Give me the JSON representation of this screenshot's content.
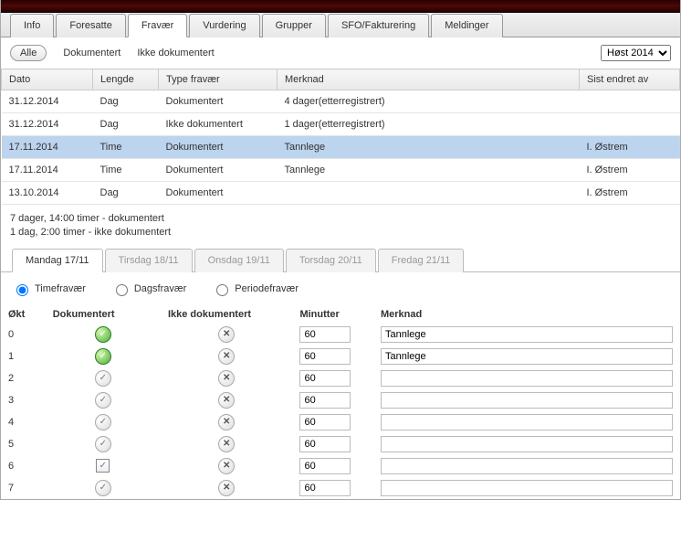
{
  "tabs": {
    "info": "Info",
    "foresatte": "Foresatte",
    "fravaer": "Fravær",
    "vurdering": "Vurdering",
    "grupper": "Grupper",
    "sfo": "SFO/Fakturering",
    "meldinger": "Meldinger"
  },
  "filter": {
    "alle": "Alle",
    "dokumentert": "Dokumentert",
    "ikke_dokumentert": "Ikke dokumentert",
    "semester": "Høst 2014"
  },
  "grid": {
    "headers": {
      "dato": "Dato",
      "lengde": "Lengde",
      "type": "Type fravær",
      "merknad": "Merknad",
      "sist": "Sist endret av"
    },
    "rows": [
      {
        "dato": "31.12.2014",
        "lengde": "Dag",
        "type": "Dokumentert",
        "merknad": "4 dager(etterregistrert)",
        "sist": "",
        "sel": false
      },
      {
        "dato": "31.12.2014",
        "lengde": "Dag",
        "type": "Ikke dokumentert",
        "merknad": "1 dager(etterregistrert)",
        "sist": "",
        "sel": false
      },
      {
        "dato": "17.11.2014",
        "lengde": "Time",
        "type": "Dokumentert",
        "merknad": "Tannlege",
        "sist": "I. Østrem",
        "sel": true
      },
      {
        "dato": "17.11.2014",
        "lengde": "Time",
        "type": "Dokumentert",
        "merknad": "Tannlege",
        "sist": "I. Østrem",
        "sel": false
      },
      {
        "dato": "13.10.2014",
        "lengde": "Dag",
        "type": "Dokumentert",
        "merknad": "",
        "sist": "I. Østrem",
        "sel": false
      }
    ]
  },
  "summary": {
    "line1": "7 dager, 14:00 timer - dokumentert",
    "line2": "1 dag, 2:00 timer - ikke dokumentert"
  },
  "days": {
    "mon": "Mandag 17/11",
    "tue": "Tirsdag 18/11",
    "wed": "Onsdag 19/11",
    "thu": "Torsdag 20/11",
    "fri": "Fredag 21/11"
  },
  "radios": {
    "time": "Timefravær",
    "dag": "Dagsfravær",
    "periode": "Periodefravær"
  },
  "okt": {
    "headers": {
      "okt": "Økt",
      "dok": "Dokumentert",
      "ikke": "Ikke dokumentert",
      "min": "Minutter",
      "merk": "Merknad"
    },
    "rows": [
      {
        "n": "0",
        "dok": "green",
        "min": "60",
        "merk": "Tannlege"
      },
      {
        "n": "1",
        "dok": "green",
        "min": "60",
        "merk": "Tannlege"
      },
      {
        "n": "2",
        "dok": "gray",
        "min": "60",
        "merk": ""
      },
      {
        "n": "3",
        "dok": "gray",
        "min": "60",
        "merk": ""
      },
      {
        "n": "4",
        "dok": "gray",
        "min": "60",
        "merk": ""
      },
      {
        "n": "5",
        "dok": "gray",
        "min": "60",
        "merk": ""
      },
      {
        "n": "6",
        "dok": "square",
        "min": "60",
        "merk": ""
      },
      {
        "n": "7",
        "dok": "gray",
        "min": "60",
        "merk": ""
      }
    ]
  }
}
